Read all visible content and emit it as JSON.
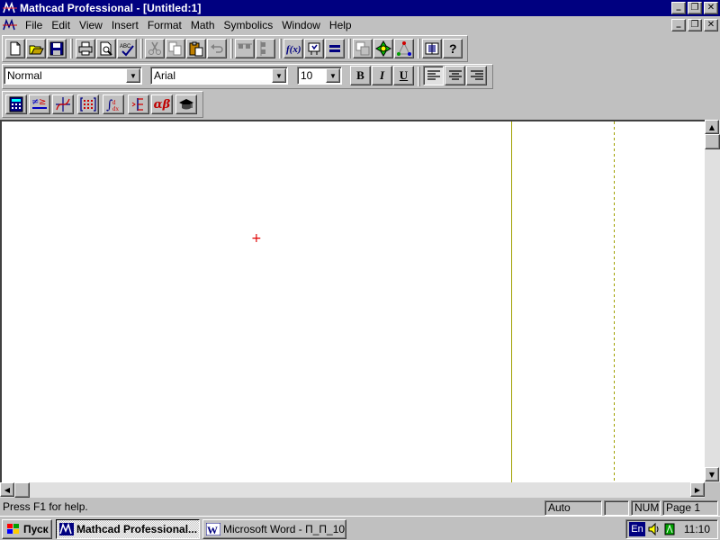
{
  "window": {
    "title": "Mathcad Professional - [Untitled:1]",
    "controls": {
      "minimize": "_",
      "maximize": "❐",
      "close": "✕"
    }
  },
  "menu": {
    "items": [
      {
        "label": "File"
      },
      {
        "label": "Edit"
      },
      {
        "label": "View"
      },
      {
        "label": "Insert"
      },
      {
        "label": "Format"
      },
      {
        "label": "Math"
      },
      {
        "label": "Symbolics"
      },
      {
        "label": "Window"
      },
      {
        "label": "Help"
      }
    ]
  },
  "standard_toolbar": {
    "buttons": [
      "new-icon",
      "open-icon",
      "save-icon",
      "print-icon",
      "print-preview-icon",
      "spell-check-icon",
      "cut-icon",
      "copy-icon",
      "paste-icon",
      "undo-icon",
      "align-horizontal-icon",
      "align-vertical-icon",
      "insert-function-icon",
      "insert-unit-icon",
      "calculate-icon",
      "component-icon",
      "resources-icon",
      "insert-component-icon",
      "quicksheets-icon",
      "help-icon"
    ]
  },
  "formatting_toolbar": {
    "style": "Normal",
    "font": "Arial",
    "size": "10",
    "bold": "B",
    "italic": "I",
    "underline": "U"
  },
  "math_toolbar": {
    "buttons": [
      "calculator-icon",
      "boolean-icon",
      "graph-icon",
      "matrix-icon",
      "calculus-icon",
      "programming-icon",
      "greek-icon",
      "symbolic-keyword-icon"
    ],
    "greek_label": "αβ"
  },
  "statusbar": {
    "help": "Press F1 for help.",
    "mode": "Auto",
    "num": "NUM",
    "page": "Page 1"
  },
  "taskbar": {
    "start": "Пуск",
    "tasks": [
      {
        "label": "Mathcad Professional...",
        "active": true
      },
      {
        "label": "Microsoft Word - П_П_10....",
        "active": false
      }
    ],
    "lang": "En",
    "time": "11:10"
  },
  "colors": {
    "titlebar": "#000080",
    "chrome": "#c0c0c0",
    "crosshair": "#e00000",
    "margin_line": "#a0a000"
  }
}
